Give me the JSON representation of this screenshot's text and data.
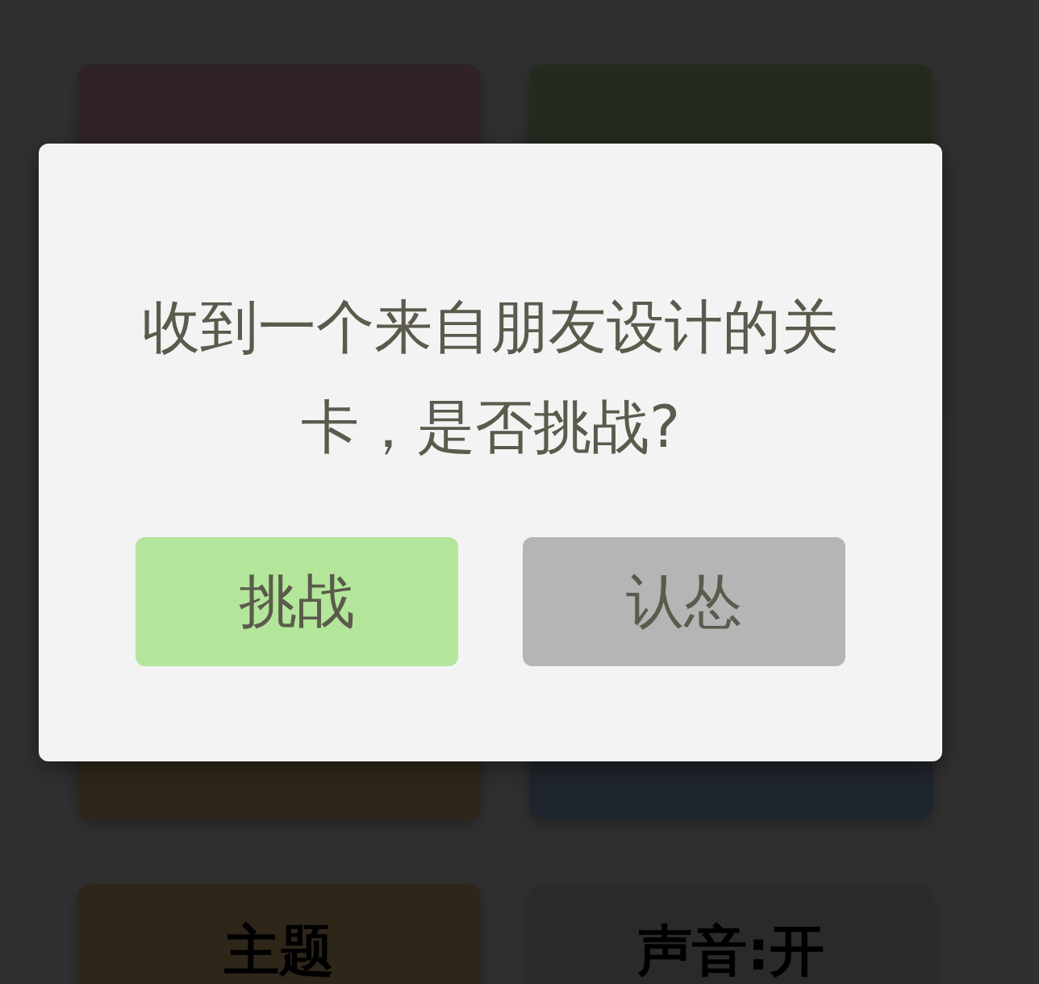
{
  "background_cards": [
    {
      "color": "#2f2228"
    },
    {
      "color": "#232b1f"
    },
    {
      "color": "#2e2619"
    },
    {
      "color": "#1f252c"
    },
    {
      "color": "#2e2619",
      "label": "主题"
    },
    {
      "color": "#2a2a2a",
      "label": "声音:开"
    }
  ],
  "dialog": {
    "message": "收到一个来自朋友设计的关卡，是否挑战?",
    "buttons": [
      {
        "label": "挑战",
        "kind": "confirm"
      },
      {
        "label": "认怂",
        "kind": "cancel"
      }
    ]
  }
}
